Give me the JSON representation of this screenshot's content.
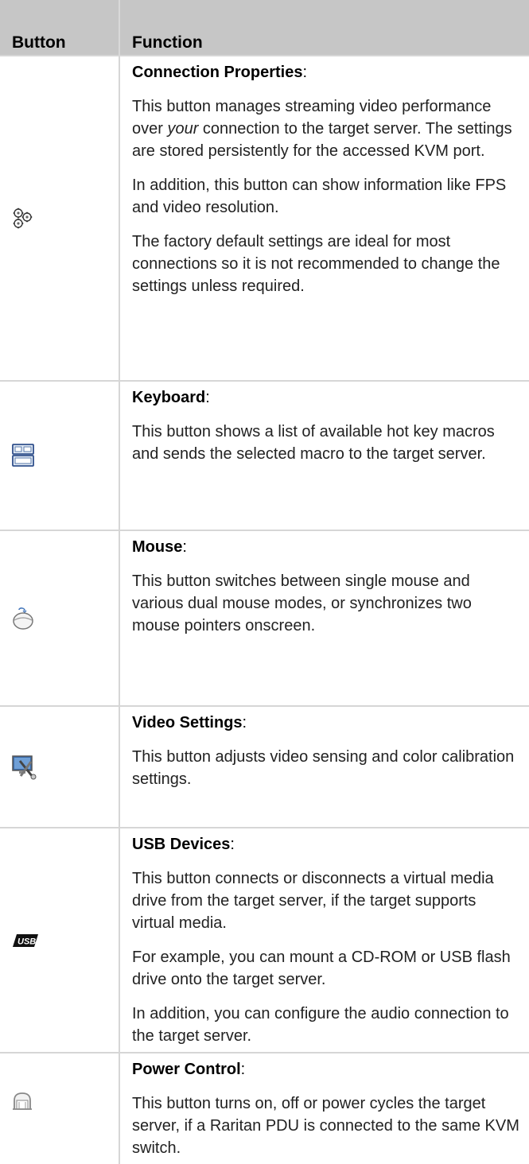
{
  "header": {
    "button_col": "Button",
    "function_col": "Function"
  },
  "rows": [
    {
      "icon": "connection-properties-gears-icon",
      "title": "Connection Properties",
      "colon": ":",
      "paragraphs": [
        [
          "This button manages streaming video performance over ",
          "your",
          " connection to the target server. The settings are stored persistently for the accessed KVM port."
        ],
        "In addition, this button can show information like FPS and video resolution.",
        "The factory default settings are ideal for most connections so it is not recommended to change the settings unless required."
      ]
    },
    {
      "icon": "keyboard-icon",
      "title": "Keyboard",
      "colon": ":",
      "paragraphs": [
        "This button shows a list of available hot key macros and sends the selected macro to the target server."
      ]
    },
    {
      "icon": "mouse-icon",
      "title": "Mouse",
      "colon": ":",
      "paragraphs": [
        "This button switches between single mouse and various dual mouse modes, or synchronizes two mouse pointers onscreen."
      ]
    },
    {
      "icon": "video-settings-monitor-tools-icon",
      "title": "Video Settings",
      "colon": ":",
      "paragraphs": [
        "This button adjusts video sensing and color calibration settings."
      ]
    },
    {
      "icon": "usb-icon",
      "title": "USB Devices",
      "colon": ":",
      "paragraphs": [
        "This button connects or disconnects a virtual media drive from the target server, if the target supports virtual media.",
        "For example, you can mount a CD-ROM or USB flash drive onto the target server.",
        "In addition, you can configure the audio connection to the target server."
      ]
    },
    {
      "icon": "power-control-icon",
      "title": "Power Control",
      "colon": ":",
      "paragraphs": [
        "This button turns on, off or power cycles the target server, if a Raritan PDU is connected to the same KVM switch."
      ]
    }
  ]
}
